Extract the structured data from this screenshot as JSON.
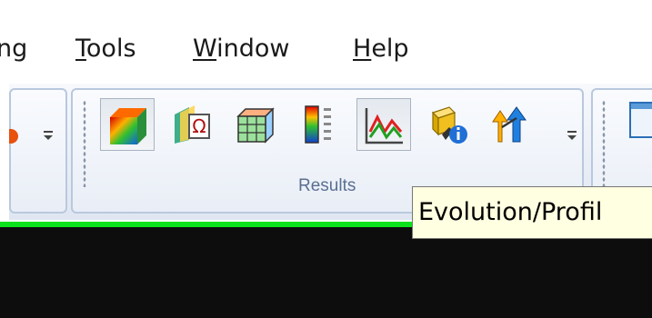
{
  "menu": {
    "items": [
      {
        "prefix": "",
        "underline": "",
        "rest": "ng"
      },
      {
        "prefix": "",
        "underline": "T",
        "rest": "ools"
      },
      {
        "prefix": "",
        "underline": "W",
        "rest": "indow"
      },
      {
        "prefix": "",
        "underline": "H",
        "rest": "elp"
      }
    ]
  },
  "ribbon": {
    "results_group_label": "Results",
    "buttons": [
      {
        "name": "iso-volume-icon"
      },
      {
        "name": "cut-plane-omega-icon"
      },
      {
        "name": "mesh-cube-icon"
      },
      {
        "name": "color-scale-legend-icon"
      },
      {
        "name": "evolution-profile-chart-icon"
      },
      {
        "name": "element-info-icon"
      },
      {
        "name": "flow-arrows-icon"
      }
    ]
  },
  "tooltip": {
    "text": "Evolution/Profil"
  },
  "colors": {
    "green_strip": "#0be21b",
    "dark_pane": "#0d0d0d",
    "tooltip_bg": "#ffffe1"
  }
}
